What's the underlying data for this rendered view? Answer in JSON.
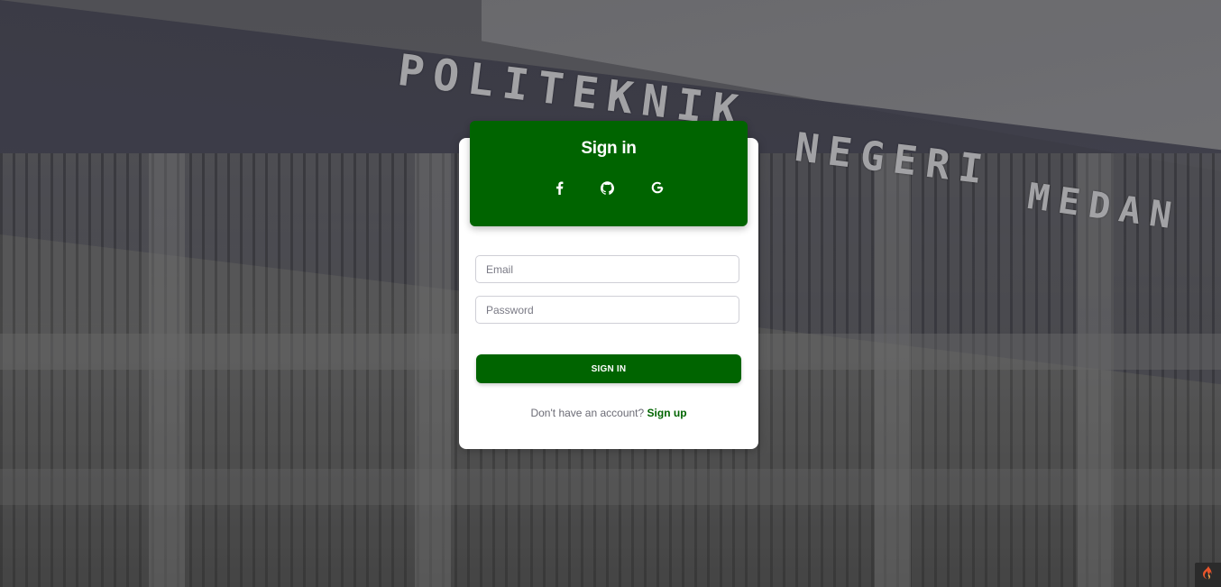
{
  "background": {
    "sign_line_1": "POLITEKNIK",
    "sign_line_2": "NEGERI",
    "sign_line_3": "MEDAN"
  },
  "header": {
    "title": "Sign in",
    "social": [
      {
        "icon": "facebook-icon"
      },
      {
        "icon": "github-icon"
      },
      {
        "icon": "google-icon"
      }
    ]
  },
  "form": {
    "email": {
      "value": "",
      "placeholder": "Email"
    },
    "password": {
      "value": "",
      "placeholder": "Password"
    },
    "submit_label": "SIGN IN"
  },
  "footer": {
    "prompt": "Don't have an account?",
    "link_label": "Sign up"
  },
  "colors": {
    "brand_green": "#006400",
    "card_bg": "#ffffff",
    "muted_text": "#6b6b75"
  },
  "corner_badge": {
    "icon": "flame-icon"
  }
}
